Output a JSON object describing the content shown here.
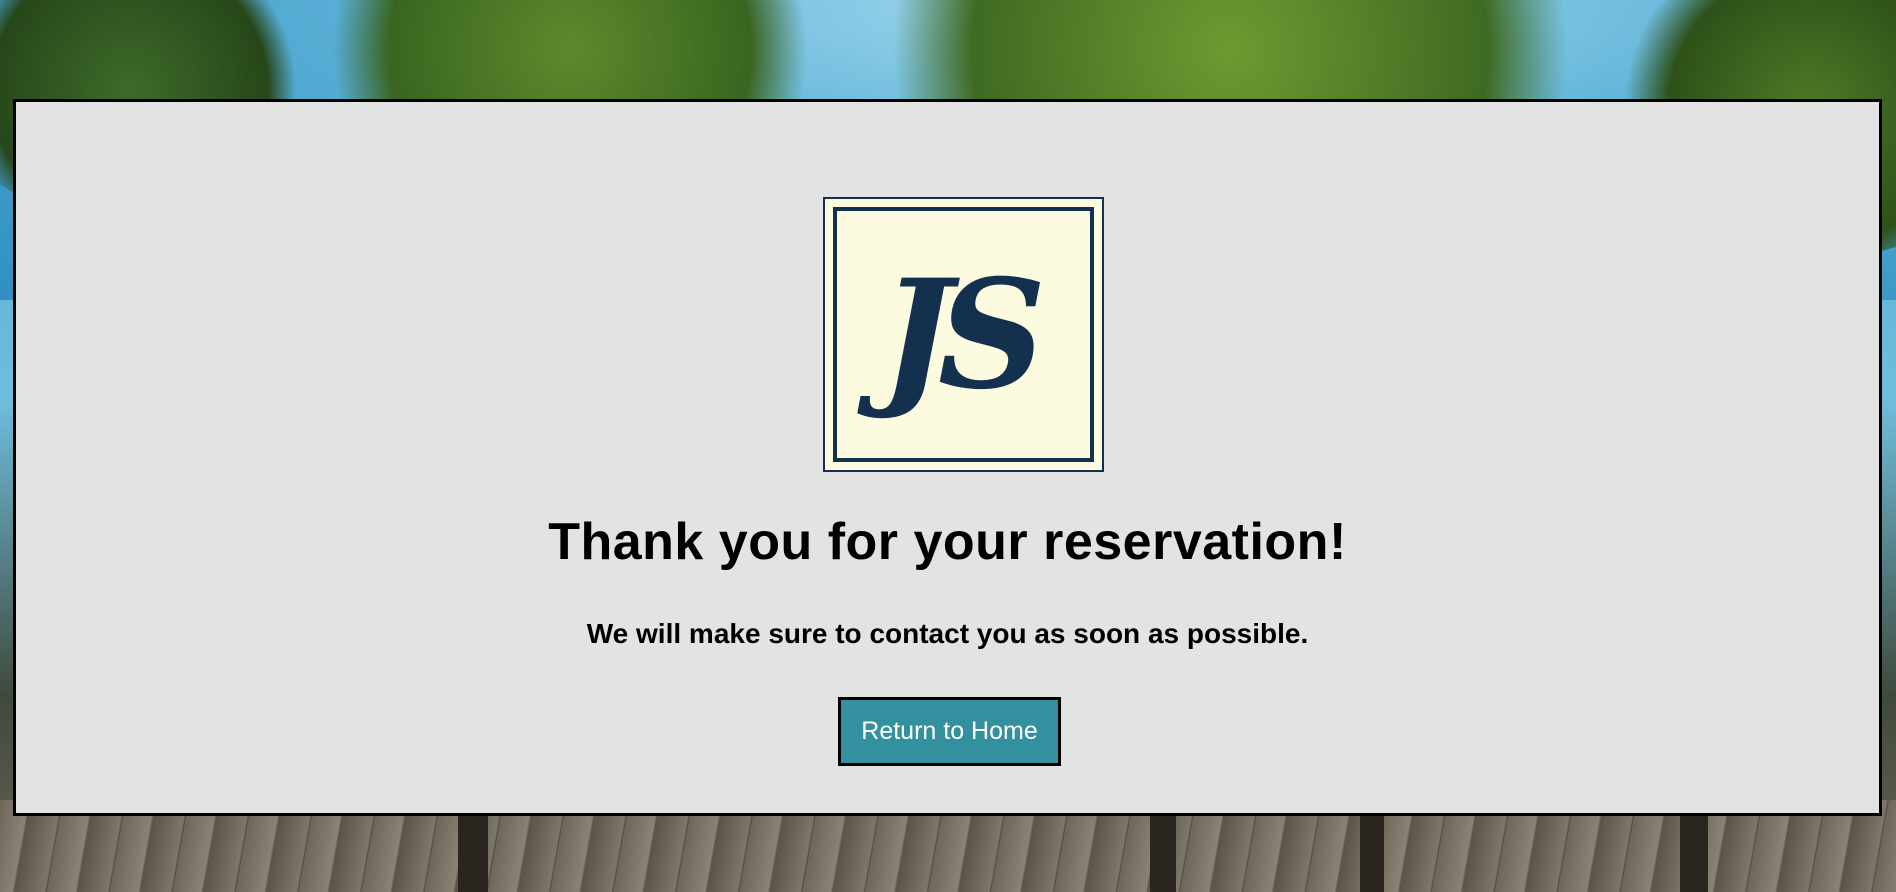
{
  "logo": {
    "monogram": "JS"
  },
  "message": {
    "title": "Thank you for your reservation!",
    "subtitle": "We will make sure to contact you as soon as possible."
  },
  "actions": {
    "return_label": "Return to Home"
  },
  "colors": {
    "card_background": "#e3e3e3",
    "logo_background": "#fcfadf",
    "logo_ink": "#14304f",
    "button_background": "#33909e",
    "button_text": "#ffffff",
    "border": "#000000"
  }
}
